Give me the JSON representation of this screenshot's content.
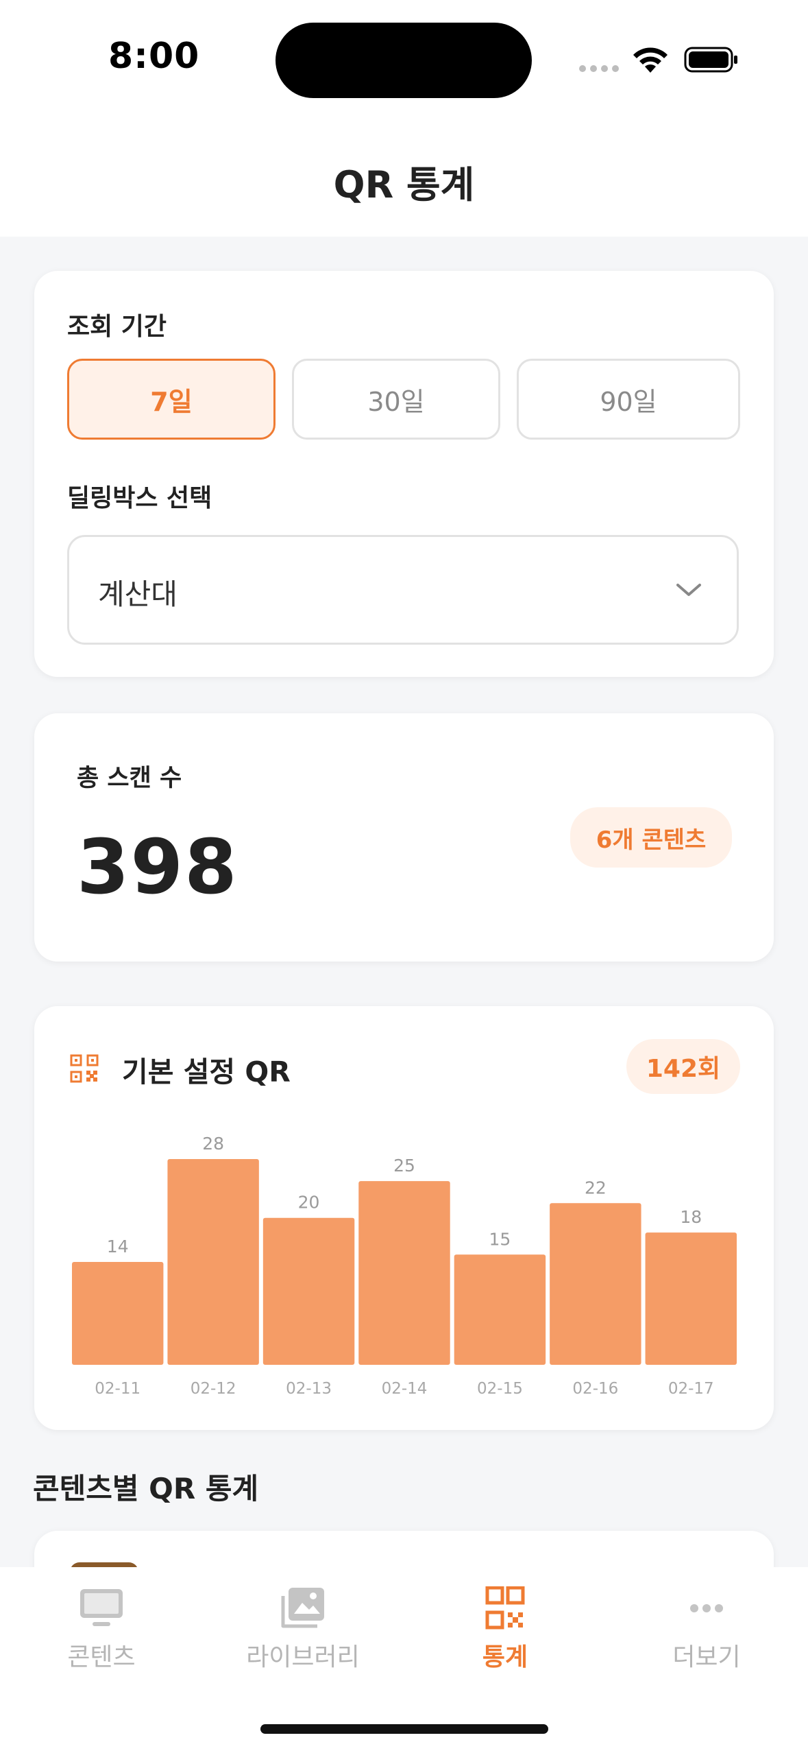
{
  "status": {
    "time": "8:00"
  },
  "header": {
    "title": "QR 통계"
  },
  "filter": {
    "period_label": "조회 기간",
    "periods": [
      "7일",
      "30일",
      "90일"
    ],
    "selected_period": "7일",
    "dealbox_label": "딜링박스 선택",
    "dealbox_value": "계산대"
  },
  "total": {
    "label": "총 스캔 수",
    "value": "398",
    "contents_badge": "6개 콘텐츠"
  },
  "qr_chart": {
    "title": "기본 설정 QR",
    "count_badge": "142회"
  },
  "chart_data": {
    "type": "bar",
    "categories": [
      "02-11",
      "02-12",
      "02-13",
      "02-14",
      "02-15",
      "02-16",
      "02-17"
    ],
    "values": [
      14,
      28,
      20,
      25,
      15,
      22,
      18
    ],
    "ylim": [
      0,
      28
    ],
    "bar_color": "#f59c66",
    "grid": false
  },
  "section": {
    "title": "콘텐츠별 QR 통계"
  },
  "tabbar": {
    "items": [
      {
        "label": "콘텐츠",
        "icon": "monitor-icon"
      },
      {
        "label": "라이브러리",
        "icon": "gallery-icon"
      },
      {
        "label": "통계",
        "icon": "qr-icon"
      },
      {
        "label": "더보기",
        "icon": "more-icon"
      }
    ],
    "active": "통계"
  },
  "colors": {
    "accent": "#ef7b32",
    "accent_light": "#fff1e8",
    "bar": "#f59c66"
  }
}
